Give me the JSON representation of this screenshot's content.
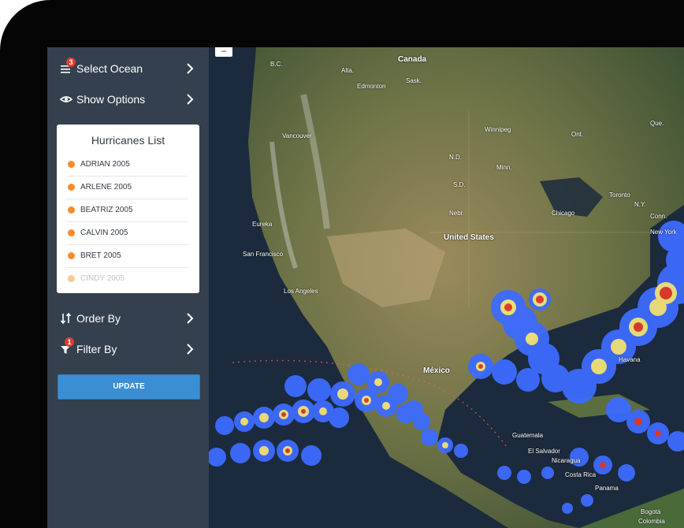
{
  "sidebar": {
    "select_ocean": {
      "label": "Select Ocean",
      "badge": "3"
    },
    "show_options": {
      "label": "Show Options"
    },
    "hurricanes": {
      "title": "Hurricanes List",
      "items": [
        {
          "label": "ADRIAN 2005"
        },
        {
          "label": "ARLENE 2005"
        },
        {
          "label": "BEATRIZ 2005"
        },
        {
          "label": "CALVIN 2005"
        },
        {
          "label": "BRET 2005"
        },
        {
          "label": "CINDY 2005"
        }
      ]
    },
    "order_by": {
      "label": "Order By"
    },
    "filter_by": {
      "label": "Filter By",
      "badge": "1"
    },
    "update_label": "UPDATE"
  },
  "map": {
    "zoom_out": "−",
    "labels": {
      "canada": "Canada",
      "bc": "B.C.",
      "alta": "Alta.",
      "sask": "Sask.",
      "edmonton": "Edmonton",
      "vancouver": "Vancouver",
      "winnipeg": "Winnipeg",
      "que": "Que.",
      "ont": "Ont.",
      "nd": "N.D.",
      "minn": "Minn.",
      "sd": "S.D.",
      "toronto": "Toronto",
      "ny": "N.Y.",
      "conn": "Conn.",
      "newyork": "New York",
      "chicago": "Chicago",
      "eureka": "Eureka",
      "sanfrancisco": "San Francisco",
      "losangeles": "Los Angeles",
      "unitedstates": "United States",
      "nebr": "Nebr.",
      "mexico": "México",
      "havana": "Havana",
      "guatemala": "Guatemala",
      "elsalvador": "El Salvador",
      "nicaragua": "Nicaragua",
      "costarica": "Costa Rica",
      "panama": "Panama",
      "bogota": "Bogotá",
      "colombia": "Colombia"
    }
  },
  "colors": {
    "sidebar_bg": "#34404d",
    "accent": "#3a8fd4",
    "badge": "#e03c31",
    "list_dot": "#ff8a2a",
    "track_outer": "#3d6bff",
    "track_mid": "#f2e37a",
    "track_core": "#e23b2b"
  },
  "icons": {
    "select_ocean": "layers-icon",
    "show_options": "eye-icon",
    "order_by": "sort-icon",
    "filter_by": "filter-icon",
    "chevron": "chevron-right-icon"
  }
}
